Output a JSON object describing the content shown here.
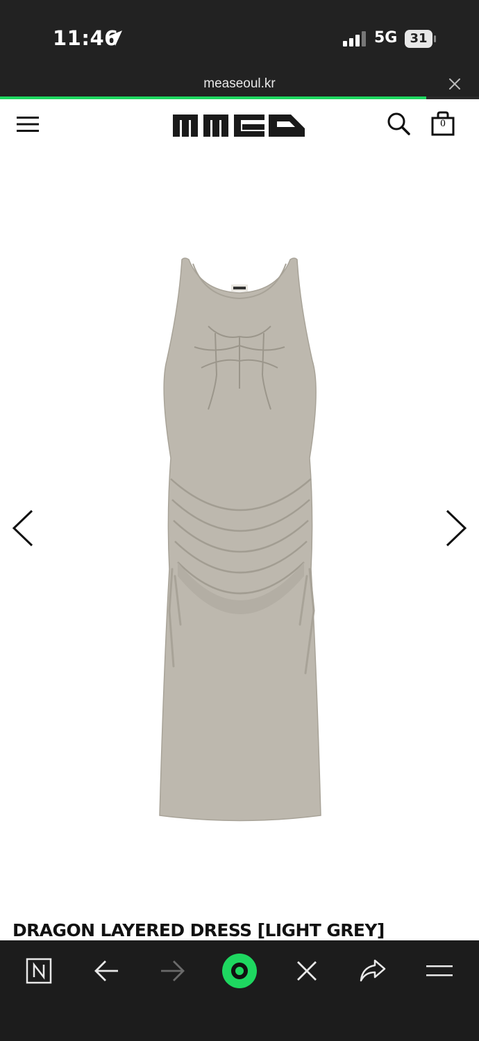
{
  "status_bar": {
    "time": "11:46",
    "network": "5G",
    "battery": "31",
    "icons": [
      "location-arrow-icon",
      "signal-icon",
      "battery-icon"
    ]
  },
  "browser": {
    "url": "measeoul.kr",
    "load_progress": 0.89,
    "accent_color": "#1ed760"
  },
  "header": {
    "cart_count": "0",
    "icons": [
      "menu-icon",
      "search-icon",
      "shopping-bag-icon"
    ]
  },
  "product": {
    "title": "DRAGON LAYERED DRESS [LIGHT GREY]",
    "color_swatch": "#bdb8ae"
  },
  "bottom_nav": {
    "items": [
      "naver-n-icon",
      "back-arrow-icon",
      "forward-arrow-icon",
      "home-icon",
      "close-icon",
      "share-icon",
      "menu-icon"
    ]
  }
}
